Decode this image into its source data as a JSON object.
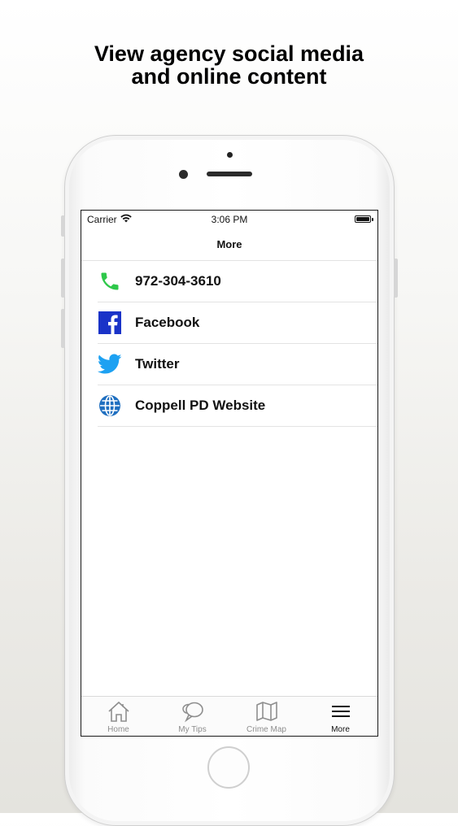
{
  "headline": {
    "line1": "View agency social media",
    "line2": "and online content"
  },
  "status_bar": {
    "carrier": "Carrier",
    "time": "3:06 PM"
  },
  "nav": {
    "title": "More"
  },
  "list": [
    {
      "label": "972-304-3610",
      "icon": "phone-icon",
      "color": "#2ec84a"
    },
    {
      "label": "Facebook",
      "icon": "facebook-icon",
      "color": "#1a33c8"
    },
    {
      "label": "Twitter",
      "icon": "twitter-icon",
      "color": "#1da1f2"
    },
    {
      "label": "Coppell PD Website",
      "icon": "globe-icon",
      "color": "#1f6fc0"
    }
  ],
  "tabs": [
    {
      "label": "Home",
      "icon": "home-icon",
      "active": false
    },
    {
      "label": "My Tips",
      "icon": "chat-bubbles-icon",
      "active": false
    },
    {
      "label": "Crime Map",
      "icon": "map-icon",
      "active": false
    },
    {
      "label": "More",
      "icon": "menu-icon",
      "active": true
    }
  ],
  "colors": {
    "tab_inactive": "#8e8e8e",
    "tab_active": "#111111"
  }
}
